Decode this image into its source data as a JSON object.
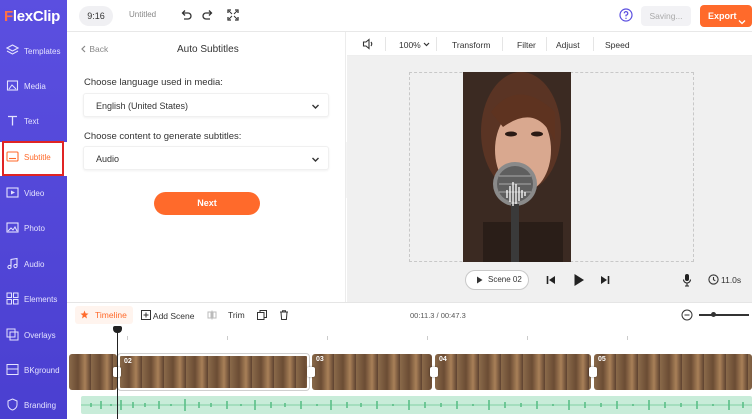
{
  "brand": {
    "logo_f": "F",
    "logo_rest": "lexClip",
    "accent": "#ff6a2b",
    "nav_bg": "#5b4fe0"
  },
  "nav": {
    "items": [
      {
        "label": "Templates",
        "icon": "layers-icon"
      },
      {
        "label": "Media",
        "icon": "media-icon"
      },
      {
        "label": "Text",
        "icon": "text-icon"
      },
      {
        "label": "Subtitle",
        "icon": "subtitle-icon",
        "active": true
      },
      {
        "label": "Video",
        "icon": "video-icon"
      },
      {
        "label": "Photo",
        "icon": "photo-icon"
      },
      {
        "label": "Audio",
        "icon": "audio-icon"
      },
      {
        "label": "Elements",
        "icon": "elements-icon"
      },
      {
        "label": "Overlays",
        "icon": "overlays-icon"
      },
      {
        "label": "BKground",
        "icon": "background-icon"
      },
      {
        "label": "Branding",
        "icon": "branding-icon"
      }
    ]
  },
  "topbar": {
    "ratio": "9:16",
    "title": "Untitled",
    "saving": "Saving...",
    "export": "Export"
  },
  "panel": {
    "back": "Back",
    "title": "Auto Subtitles",
    "language_label": "Choose language used in media:",
    "language_value": "English (United States)",
    "content_label": "Choose content to generate subtitles:",
    "content_value": "Audio",
    "next": "Next"
  },
  "preview_toolbar": {
    "zoom": "100%",
    "transform": "Transform",
    "filter": "Filter",
    "adjust": "Adjust",
    "speed": "Speed"
  },
  "playback": {
    "scene": "Scene 02",
    "duration": "11.0s"
  },
  "timeline": {
    "timeline_label": "Timeline",
    "add_scene": "Add Scene",
    "trim": "Trim",
    "time": "00:11.3 / 00:47.3",
    "clips": [
      {
        "num": ""
      },
      {
        "num": "02",
        "selected": true
      },
      {
        "num": "03"
      },
      {
        "num": "04"
      },
      {
        "num": "05"
      }
    ]
  }
}
